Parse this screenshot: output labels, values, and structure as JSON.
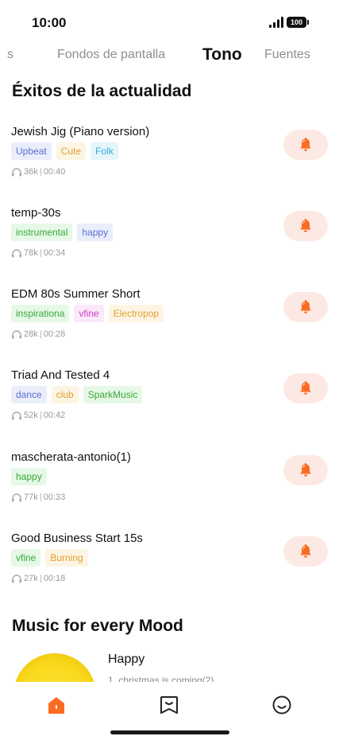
{
  "status_bar": {
    "time": "10:00",
    "battery": "100"
  },
  "top_tabs": [
    {
      "label": "s",
      "active": false
    },
    {
      "label": "Fondos de pantalla",
      "active": false
    },
    {
      "label": "Tono",
      "active": true
    },
    {
      "label": "Fuentes",
      "active": false
    }
  ],
  "trending": {
    "title": "Éxitos de la actualidad",
    "songs": [
      {
        "title": "Jewish Jig (Piano version)",
        "tags": [
          {
            "label": "Upbeat",
            "color": "#5a6fd0",
            "bg": "#eaeefb"
          },
          {
            "label": "Cute",
            "color": "#e0a030",
            "bg": "#fdf5e4"
          },
          {
            "label": "Folk",
            "color": "#38a8d8",
            "bg": "#e4f5fc"
          }
        ],
        "plays": "36k",
        "duration": "00:40"
      },
      {
        "title": "temp-30s",
        "tags": [
          {
            "label": "instrumental",
            "color": "#3aa83a",
            "bg": "#e6f8e6"
          },
          {
            "label": "happy",
            "color": "#5a6fd0",
            "bg": "#eaeefb"
          }
        ],
        "plays": "78k",
        "duration": "00:34"
      },
      {
        "title": "EDM 80s Summer Short",
        "tags": [
          {
            "label": "inspirationa",
            "color": "#3aa83a",
            "bg": "#e6f8e6"
          },
          {
            "label": "vfine",
            "color": "#d040c8",
            "bg": "#fbe8fa"
          },
          {
            "label": "Electropop",
            "color": "#e0a030",
            "bg": "#fdf5e4"
          }
        ],
        "plays": "28k",
        "duration": "00:28"
      },
      {
        "title": "Triad And Tested 4",
        "tags": [
          {
            "label": "dance",
            "color": "#5a6fd0",
            "bg": "#eaeefb"
          },
          {
            "label": "club",
            "color": "#e0a030",
            "bg": "#fdf5e4"
          },
          {
            "label": "SparkMusic",
            "color": "#3aa83a",
            "bg": "#e6f8e6"
          }
        ],
        "plays": "52k",
        "duration": "00:42"
      },
      {
        "title": "mascherata-antonio(1)",
        "tags": [
          {
            "label": "happy",
            "color": "#3aa83a",
            "bg": "#e6f8e6"
          }
        ],
        "plays": "77k",
        "duration": "00:33"
      },
      {
        "title": "Good Business Start 15s",
        "tags": [
          {
            "label": "vfine",
            "color": "#3aa83a",
            "bg": "#e6f8e6"
          },
          {
            "label": "Burning",
            "color": "#e0a030",
            "bg": "#fdf5e4"
          }
        ],
        "plays": "27k",
        "duration": "00:18"
      }
    ]
  },
  "mood": {
    "title": "Music for every Mood",
    "item_name": "Happy",
    "item_sub": "1. christmas is coming(2)"
  },
  "bottom_nav": [
    {
      "icon": "home-icon",
      "active": true
    },
    {
      "icon": "bookmark-icon",
      "active": false
    },
    {
      "icon": "smiley-icon",
      "active": false
    }
  ],
  "colors": {
    "accent": "#fb6c23",
    "bell_bg": "#fde9e3"
  }
}
